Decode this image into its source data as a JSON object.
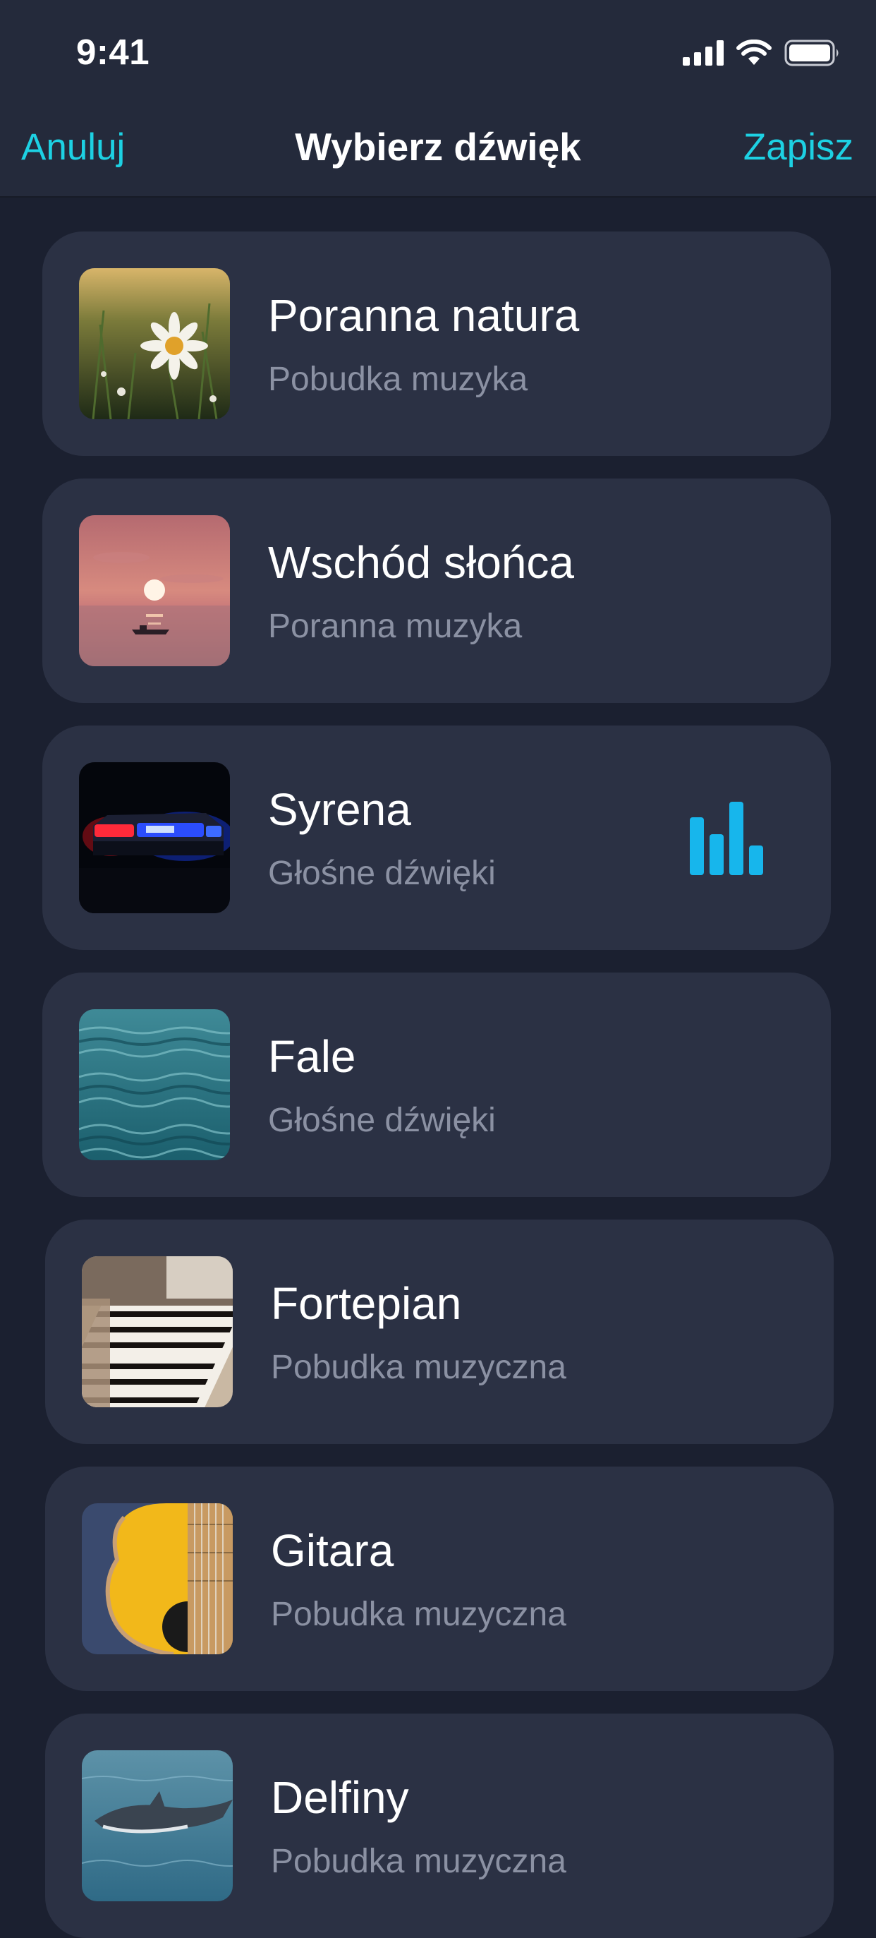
{
  "status_bar": {
    "time": "9:41",
    "icons": [
      "cellular-signal-icon",
      "wifi-icon",
      "battery-icon"
    ]
  },
  "nav": {
    "cancel_label": "Anuluj",
    "title": "Wybierz dźwięk",
    "save_label": "Zapisz"
  },
  "colors": {
    "accent": "#1dd1e3",
    "playing_indicator": "#17b6ec",
    "background": "#1b2030",
    "card": "#2b3144",
    "subtitle": "#8b91a3"
  },
  "sounds": [
    {
      "title": "Poranna natura",
      "subtitle": "Pobudka muzyka",
      "image": "daisy-field-image"
    },
    {
      "title": "Wschód słońca",
      "subtitle": "Poranna muzyka",
      "image": "sunrise-sea-image"
    },
    {
      "title": "Syrena",
      "subtitle": "Głośne dźwięki",
      "image": "police-siren-image",
      "playing": true,
      "indicator_icon": "playing-bars-icon"
    },
    {
      "title": "Fale",
      "subtitle": "Głośne dźwięki",
      "image": "ocean-waves-image"
    },
    {
      "title": "Fortepian",
      "subtitle": "Pobudka muzyczna",
      "image": "piano-keys-image"
    },
    {
      "title": "Gitara",
      "subtitle": "Pobudka muzyczna",
      "image": "acoustic-guitar-image"
    },
    {
      "title": "Delfiny",
      "subtitle": "Pobudka muzyczna",
      "image": "dolphin-image"
    }
  ]
}
